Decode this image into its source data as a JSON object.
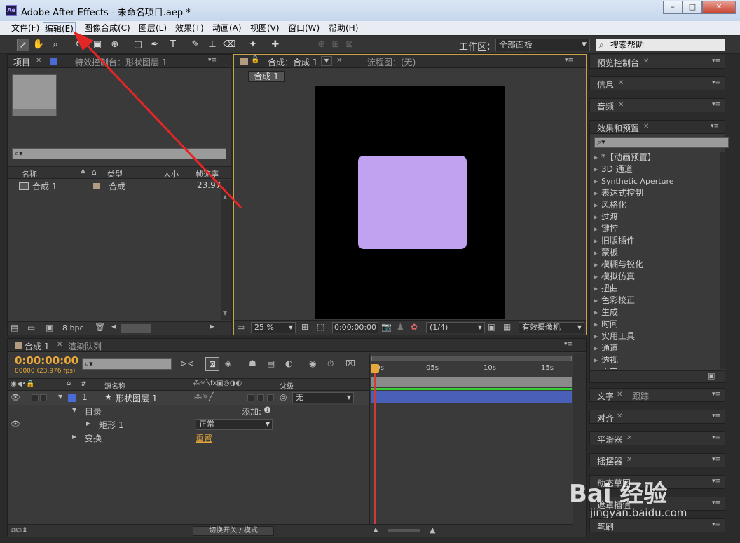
{
  "window": {
    "app_icon": "Ae",
    "title": "Adobe After Effects - 未命名项目.aep *",
    "min": "–",
    "max": "□",
    "close": "✕"
  },
  "menu": [
    "文件(F)",
    "编辑(E)",
    "图像合成(C)",
    "图层(L)",
    "效果(T)",
    "动画(A)",
    "视图(V)",
    "窗口(W)",
    "帮助(H)"
  ],
  "toolbar": {
    "workspace_label": "工作区：",
    "workspace_value": "全部面板",
    "search_placeholder": "搜索帮助"
  },
  "project_panel": {
    "tab_project": "项目",
    "tab_effects": "特效控制台：形状图层 1",
    "columns": {
      "name": "名称",
      "type": "类型",
      "size": "大小",
      "rate": "帧速率"
    },
    "items": [
      {
        "name": "合成 1",
        "type": "合成",
        "rate": "23.976"
      }
    ],
    "bpc": "8 bpc"
  },
  "comp_panel": {
    "tab_comp": "合成：合成 1",
    "tab_flow": "流程图：(无)",
    "breadcrumb": "合成 1",
    "zoom": "25 %",
    "timecode": "0:00:00:00",
    "resolution": "(1/4)",
    "camera": "有效摄像机",
    "colors": {
      "canvas": "#000000",
      "shape": "#c0a2f0"
    }
  },
  "right_panels": {
    "preview": "预览控制台",
    "info": "信息",
    "audio": "音频",
    "effects": "效果和预置",
    "effects_list": [
      "*【动画预置】",
      "3D 通道",
      "Synthetic Aperture",
      "表达式控制",
      "风格化",
      "过渡",
      "键控",
      "旧版插件",
      "蒙板",
      "模糊与锐化",
      "模拟仿真",
      "扭曲",
      "色彩校正",
      "生成",
      "时间",
      "实用工具",
      "通道",
      "透视",
      "文字"
    ],
    "text": "文字",
    "tracker": "跟踪",
    "align": "对齐",
    "smoother": "平滑器",
    "wiggler": "摇摆器",
    "motion_sketch": "动态草图",
    "mask_interp": "遮罩插值",
    "brushes": "笔刷"
  },
  "timeline": {
    "tab_comp": "合成 1",
    "tab_render": "渲染队列",
    "timecode": "0:00:00:00",
    "fps": "00000 (23.976 fps)",
    "cols": {
      "num": "#",
      "source": "源名称",
      "parent": "父级"
    },
    "layers": [
      {
        "num": "1",
        "name": "形状图层 1",
        "parent": "无"
      }
    ],
    "contents": "目录",
    "add": "添加:",
    "rect": "矩形 1",
    "blend": "正常",
    "transform": "变换",
    "reset": "重置",
    "ruler": [
      "00s",
      "05s",
      "10s",
      "15s"
    ],
    "toggle": "切换开关 / 模式"
  },
  "watermark": {
    "logo": "Bai 经验",
    "url": "jingyan.baidu.com"
  }
}
